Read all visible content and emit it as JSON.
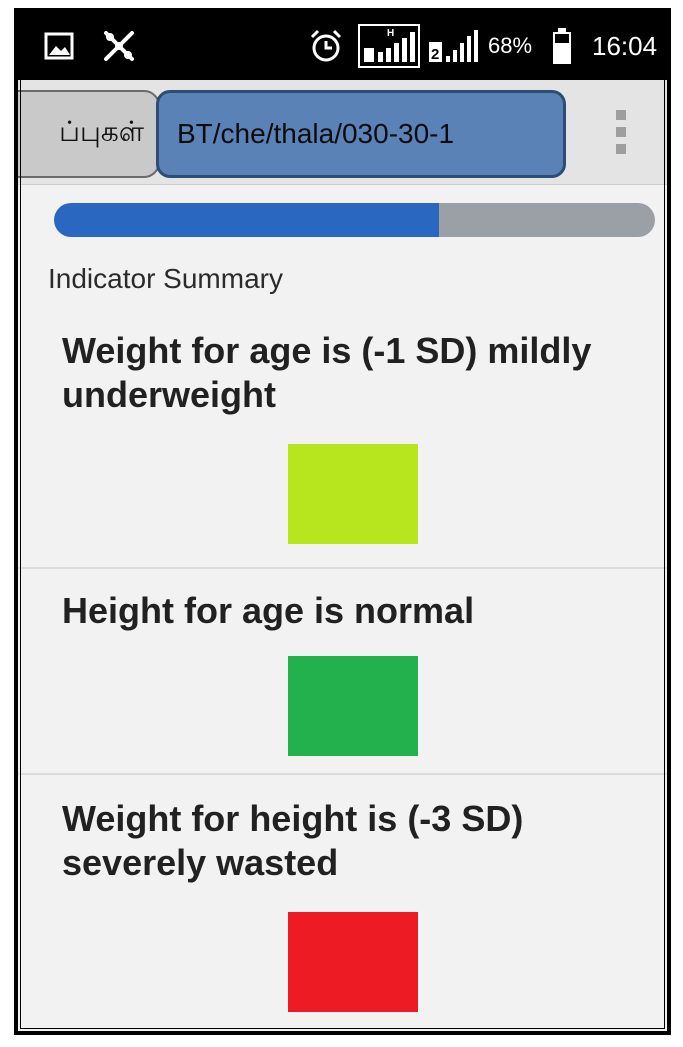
{
  "status_bar": {
    "icons": [
      "gallery-icon",
      "app-notification-icon",
      "alarm-icon",
      "signal-sim1-icon",
      "signal-sim2-icon",
      "battery-icon"
    ],
    "battery": "68%",
    "time": "16:04"
  },
  "tabs": {
    "previous_label": "ப்புகள்",
    "active_label": "BT/che/thala/030-30-1"
  },
  "progress": {
    "fraction": 0.64
  },
  "summary": {
    "title": "Indicator Summary",
    "indicators": [
      {
        "text": "Weight for age is (-1 SD) mildly underweight",
        "color": "#b7e61e"
      },
      {
        "text": "Height for age is normal",
        "color": "#22b14c"
      },
      {
        "text": "Weight for height is (-3 SD) severely wasted",
        "color": "#ed1c24"
      }
    ]
  },
  "colors": {
    "tab_active": "#5b82b6",
    "progress_fill": "#2a67c0",
    "progress_track": "#9aa0a6"
  }
}
